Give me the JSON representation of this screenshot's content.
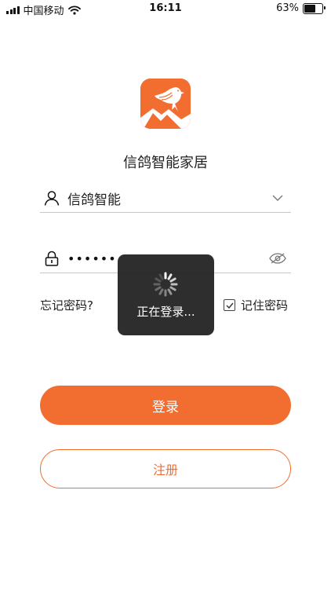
{
  "status_bar": {
    "carrier": "中国移动",
    "time": "16:11",
    "battery_percent": "63%",
    "battery_level": 0.63,
    "icons": [
      "signal-icon",
      "wifi-icon",
      "battery-icon"
    ]
  },
  "app": {
    "title": "信鸽智能家居",
    "brand_color": "#f26d30"
  },
  "login_form": {
    "username_value": "信鸽智能",
    "password_value": "••••••",
    "forgot_password_label": "忘记密码?",
    "remember_password_label": "记住密码",
    "remember_password_checked": true,
    "icons": {
      "username": "user-icon",
      "username_dropdown": "chevron-down-icon",
      "password": "lock-icon",
      "password_visibility": "eye-off-icon"
    }
  },
  "buttons": {
    "login_label": "登录",
    "register_label": "注册"
  },
  "loading_toast": {
    "text": "正在登录..."
  }
}
